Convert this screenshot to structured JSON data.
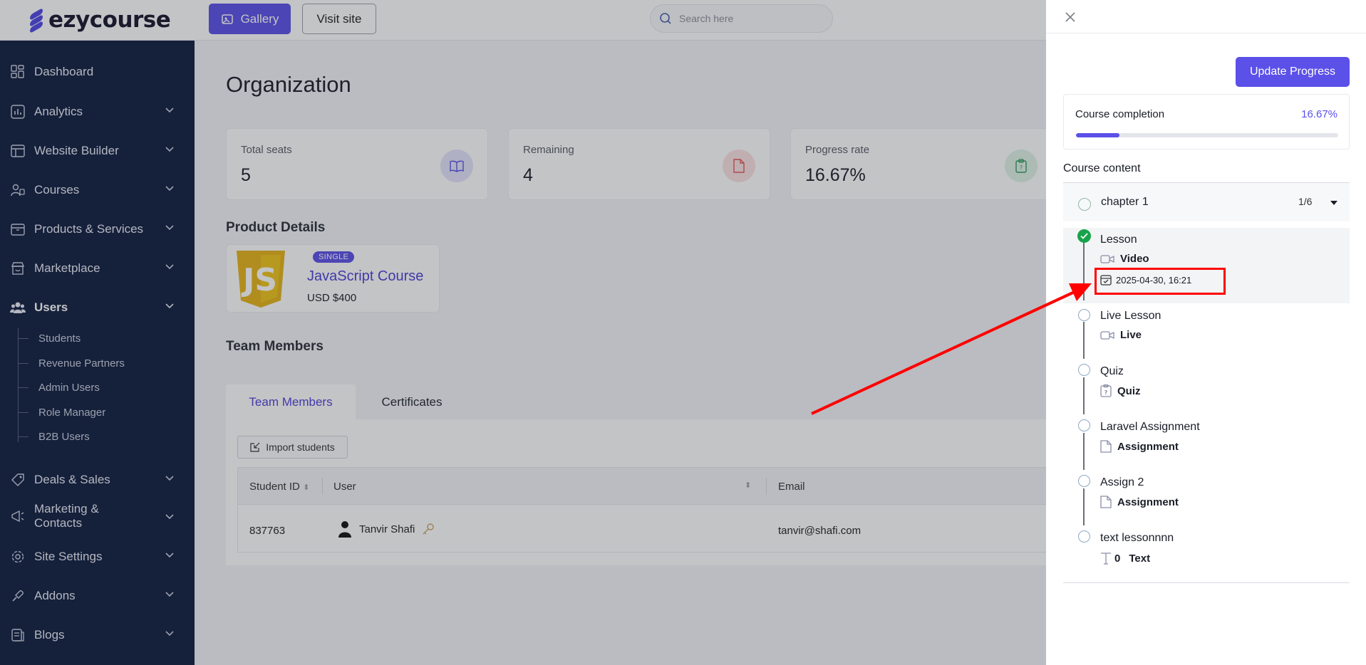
{
  "brand": {
    "name": "ezycourse",
    "accent": "#5b50e8",
    "sidebar_bg": "#0f1c3f"
  },
  "topbar": {
    "gallery_label": "Gallery",
    "visit_label": "Visit site",
    "search_placeholder": "Search here"
  },
  "sidebar": {
    "items": [
      {
        "label": "Dashboard",
        "icon": "dashboard-icon"
      },
      {
        "label": "Analytics",
        "icon": "analytics-icon"
      },
      {
        "label": "Website Builder",
        "icon": "website-builder-icon"
      },
      {
        "label": "Courses",
        "icon": "courses-icon"
      },
      {
        "label": "Products & Services",
        "icon": "products-icon"
      },
      {
        "label": "Marketplace",
        "icon": "marketplace-icon"
      },
      {
        "label": "Users",
        "icon": "users-icon"
      },
      {
        "label": "Deals & Sales",
        "icon": "deals-icon"
      },
      {
        "label": "Marketing & Contacts",
        "icon": "marketing-icon"
      },
      {
        "label": "Site Settings",
        "icon": "settings-icon"
      },
      {
        "label": "Addons",
        "icon": "addons-icon"
      },
      {
        "label": "Blogs",
        "icon": "blogs-icon"
      }
    ],
    "users_sub": [
      "Students",
      "Revenue Partners",
      "Admin Users",
      "Role Manager",
      "B2B Users"
    ]
  },
  "main": {
    "title": "Organization",
    "stats": [
      {
        "label": "Total seats",
        "value": "5"
      },
      {
        "label": "Remaining",
        "value": "4"
      },
      {
        "label": "Progress rate",
        "value": "16.67%"
      }
    ],
    "product_section": "Product Details",
    "product": {
      "badge": "SINGLE",
      "name": "JavaScript Course",
      "price": "USD $400"
    },
    "team_section": "Team Members",
    "tabs": [
      "Team Members",
      "Certificates"
    ],
    "import_label": "Import students",
    "table": {
      "headers": [
        "Student ID",
        "User",
        "Email"
      ],
      "rows": [
        {
          "id": "837763",
          "user": "Tanvir Shafi",
          "email": "tanvir@shafi.com"
        }
      ]
    }
  },
  "drawer": {
    "update_label": "Update Progress",
    "completion_label": "Course completion",
    "completion_pct": "16.67%",
    "completion_value": 0.1667,
    "content_title": "Course content",
    "chapter": {
      "name": "chapter 1",
      "count": "1/6"
    },
    "lessons": [
      {
        "title": "Lesson",
        "type": "Video",
        "done": true,
        "date": "2025-04-30, 16:21"
      },
      {
        "title": "Live Lesson",
        "type": "Live",
        "done": false
      },
      {
        "title": "Quiz",
        "type": "Quiz",
        "done": false
      },
      {
        "title": "Laravel Assignment",
        "type": "Assignment",
        "done": false
      },
      {
        "title": "Assign 2",
        "type": "Assignment",
        "done": false
      },
      {
        "title": "text lessonnnn",
        "type": "Text",
        "done": false,
        "count": "0"
      }
    ]
  }
}
